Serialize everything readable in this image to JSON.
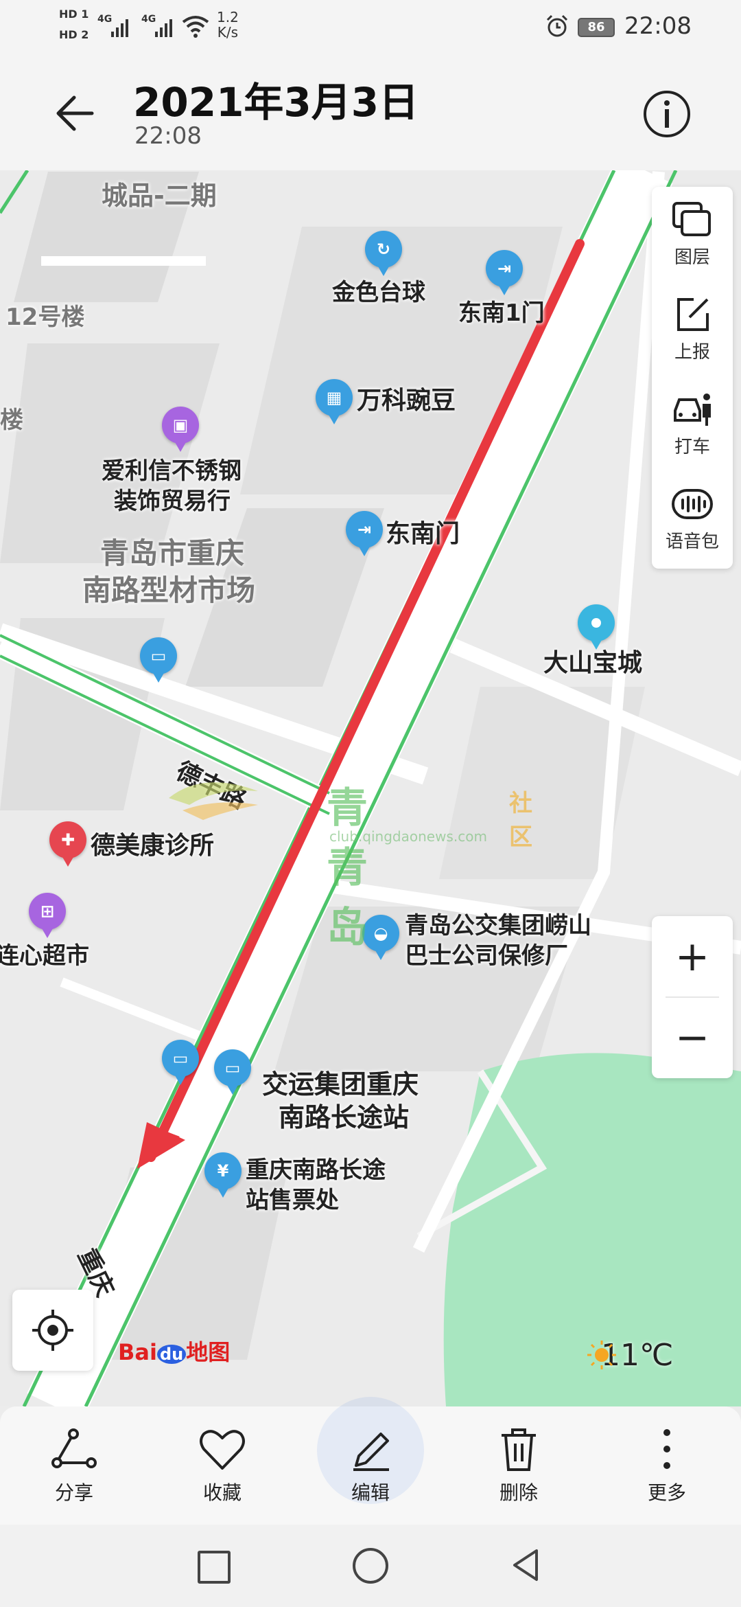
{
  "status_bar": {
    "sim1": "HD 1",
    "sim2": "HD 2",
    "net1": "4G",
    "net2": "4G",
    "speed_value": "1.2",
    "speed_unit": "K/s",
    "battery": "86",
    "time": "22:08"
  },
  "header": {
    "date": "2021年3月3日",
    "time": "22:08"
  },
  "map": {
    "areas": [
      "城品-二期",
      "12号楼",
      "楼",
      "青岛市重庆",
      "南路型材市场"
    ],
    "roads": [
      "德丰路",
      "重庆"
    ],
    "pois": [
      {
        "name": "金色台球",
        "icon": "billiards-icon",
        "color": "#3a9fe0"
      },
      {
        "name": "东南1门",
        "icon": "gate-icon",
        "color": "#3a9fe0"
      },
      {
        "name": "万科豌豆",
        "icon": "building-icon",
        "color": "#3a9fe0"
      },
      {
        "name_line1": "爱利信不锈钢",
        "name_line2": "装饰贸易行",
        "icon": "shopping-bag-icon",
        "color": "#a765e0"
      },
      {
        "name": "东南门",
        "icon": "gate-icon",
        "color": "#3a9fe0"
      },
      {
        "name": "大山宝城",
        "icon": "pin-icon",
        "color": "#3ab6e0"
      },
      {
        "name": "德美康诊所",
        "icon": "clinic-icon",
        "color": "#e64650"
      },
      {
        "name": "心连心超市",
        "icon": "supermarket-icon",
        "color": "#a765e0"
      },
      {
        "name_line1": "青岛公交集团崂山",
        "name_line2": "巴士公司保修厂",
        "icon": "car-icon",
        "color": "#3a9fe0"
      },
      {
        "name_line1": "交运集团重庆",
        "name_line2": "南路长途站",
        "icon": "bus-station-icon",
        "color": "#3a9fe0"
      },
      {
        "name_line1": "重庆南路长途",
        "name_line2": "站售票处",
        "icon": "ticket-icon",
        "color": "#3a9fe0"
      }
    ],
    "watermark": {
      "brand": "青青岛",
      "suffix": "社区",
      "url": "club.qingdaonews.com"
    },
    "logo": "Bai du 地图",
    "weather": "11℃"
  },
  "tools": [
    {
      "label": "图层",
      "icon": "layers-icon"
    },
    {
      "label": "上报",
      "icon": "report-icon"
    },
    {
      "label": "打车",
      "icon": "taxi-icon"
    },
    {
      "label": "语音包",
      "icon": "voice-pack-icon"
    }
  ],
  "zoom": {
    "in": "+",
    "out": "−"
  },
  "bottom_actions": [
    {
      "label": "分享",
      "icon": "share-icon"
    },
    {
      "label": "收藏",
      "icon": "heart-icon"
    },
    {
      "label": "编辑",
      "icon": "pencil-icon"
    },
    {
      "label": "删除",
      "icon": "trash-icon"
    },
    {
      "label": "更多",
      "icon": "more-icon"
    }
  ],
  "colors": {
    "route": "#e8383f",
    "road_green": "#4cc46a",
    "park": "#a8e6c0",
    "poi_blue": "#3a9fe0"
  }
}
